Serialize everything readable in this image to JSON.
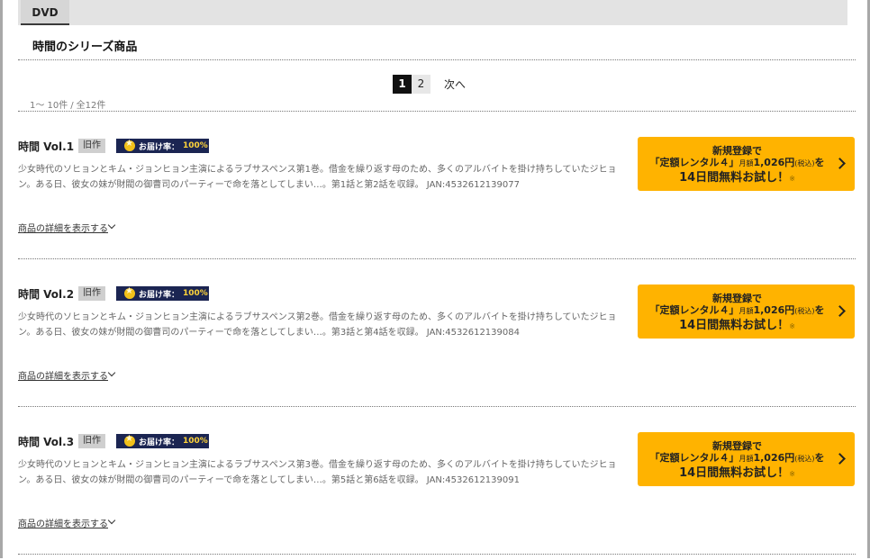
{
  "tabs": [
    {
      "label": "DVD"
    }
  ],
  "section": {
    "title": "時間のシリーズ商品"
  },
  "pagination": {
    "pages": [
      "1",
      "2"
    ],
    "current": "1",
    "next_label": "次へ"
  },
  "result_count": {
    "range": "1～ 10件",
    "sep": "/",
    "total": "全12件"
  },
  "items": [
    {
      "title": "時間 Vol.1",
      "badge_old": "旧作",
      "delivery_label": "お届け率：",
      "delivery_rate": "100%",
      "description": "少女時代のソヒョンとキム・ジョンヒョン主演によるラブサスペンス第1巻。借金を繰り返す母のため、多くのアルバイトを掛け持ちしていたジヒョン。ある日、彼女の妹が財閥の御曹司のパーティーで命を落としてしまい…。第1話と第2話を収録。 JAN:4532612139077",
      "detail_link": "商品の詳細を表示する",
      "cta": {
        "line1": "新規登録で",
        "line2_a": "「定額レンタル４」",
        "line2_small_a": "月額",
        "line2_b": "1,026円",
        "line2_small_b": "(税込)",
        "line2_c": "を",
        "line3": "14日間無料お試し！",
        "note": "※"
      }
    },
    {
      "title": "時間 Vol.2",
      "badge_old": "旧作",
      "delivery_label": "お届け率：",
      "delivery_rate": "100%",
      "description": "少女時代のソヒョンとキム・ジョンヒョン主演によるラブサスペンス第2巻。借金を繰り返す母のため、多くのアルバイトを掛け持ちしていたジヒョン。ある日、彼女の妹が財閥の御曹司のパーティーで命を落としてしまい…。第3話と第4話を収録。 JAN:4532612139084",
      "detail_link": "商品の詳細を表示する",
      "cta": {
        "line1": "新規登録で",
        "line2_a": "「定額レンタル４」",
        "line2_small_a": "月額",
        "line2_b": "1,026円",
        "line2_small_b": "(税込)",
        "line2_c": "を",
        "line3": "14日間無料お試し！",
        "note": "※"
      }
    },
    {
      "title": "時間 Vol.3",
      "badge_old": "旧作",
      "delivery_label": "お届け率：",
      "delivery_rate": "100%",
      "description": "少女時代のソヒョンとキム・ジョンヒョン主演によるラブサスペンス第3巻。借金を繰り返す母のため、多くのアルバイトを掛け持ちしていたジヒョン。ある日、彼女の妹が財閥の御曹司のパーティーで命を落としてしまい…。第5話と第6話を収録。 JAN:4532612139091",
      "detail_link": "商品の詳細を表示する",
      "cta": {
        "line1": "新規登録で",
        "line2_a": "「定額レンタル４」",
        "line2_small_a": "月額",
        "line2_b": "1,026円",
        "line2_small_b": "(税込)",
        "line2_c": "を",
        "line3": "14日間無料お試し！",
        "note": "※"
      }
    }
  ]
}
